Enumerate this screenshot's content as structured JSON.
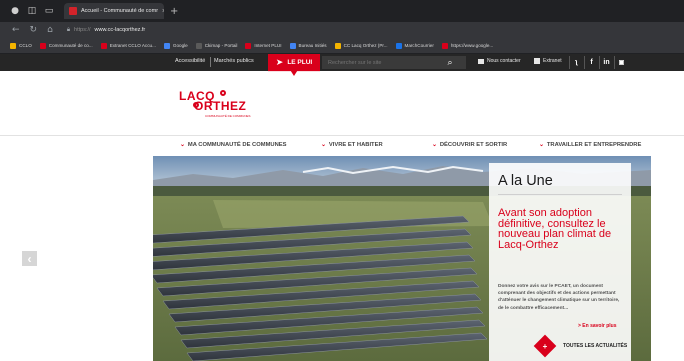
{
  "browser": {
    "tab_title": "Accueil - Communauté de comr",
    "tab_close": "×",
    "new_tab": "+",
    "url_prefix": "https://",
    "url_domain": "www.cc-lacqorthez.fr",
    "bookmarks": [
      {
        "label": "CCLO",
        "color": "#f4b400"
      },
      {
        "label": "Communauté de co...",
        "color": "#d9001b"
      },
      {
        "label": "Extranet CCLO Accu...",
        "color": "#d9001b"
      },
      {
        "label": "Google",
        "color": "#4285f4"
      },
      {
        "label": "Ckimap - Portail",
        "color": "#5a5a5a"
      },
      {
        "label": "Internet PLUI",
        "color": "#d9001b"
      },
      {
        "label": "Bureau Initiés",
        "color": "#4285f4"
      },
      {
        "label": "CC Lacq Orthez (Pr...",
        "color": "#f4b400"
      },
      {
        "label": "MarchCourrier",
        "color": "#1a73e8"
      },
      {
        "label": "https://www.google...",
        "color": "#d9001b"
      }
    ]
  },
  "topbar": {
    "accessibilite": "Accessibilité",
    "marches": "Marchés publics",
    "le_plui": "LE PLUI",
    "search_placeholder": "Rechercher sur le site",
    "contact": "Nous contacter",
    "extranet": "Extranet",
    "social": [
      "rss-icon",
      "facebook-icon",
      "linkedin-icon",
      "youtube-icon"
    ],
    "social_glyphs": [
      "ʅ",
      "f",
      "in",
      "▣"
    ]
  },
  "logo": {
    "line1": "LACQ",
    "line2": "ORTHEZ",
    "tagline": "COMMUNAUTÉ DE COMMUNES"
  },
  "mainnav": [
    {
      "label": "MA COMMUNAUTÉ DE COMMUNES"
    },
    {
      "label": "VIVRE ET HABITER"
    },
    {
      "label": "DÉCOUVRIR ET SORTIR"
    },
    {
      "label": "TRAVAILLER ET ENTREPRENDRE"
    }
  ],
  "une": {
    "title": "A la Une",
    "headline": "Avant son adoption définitive, consultez le nouveau plan climat de Lacq-Orthez",
    "desc": "Donnez votre avis sur le PCAET, un document comprenant des objectifs et des actions permettant d'atténuer le changement climatique sur un territoire, de le combattre efficacement...",
    "more": "> En savoir plus",
    "all_news": "TOUTES LES ACTUALITÉS",
    "all_plus": "+"
  },
  "colors": {
    "brand_red": "#d9001b",
    "topbar_bg": "#262626"
  }
}
